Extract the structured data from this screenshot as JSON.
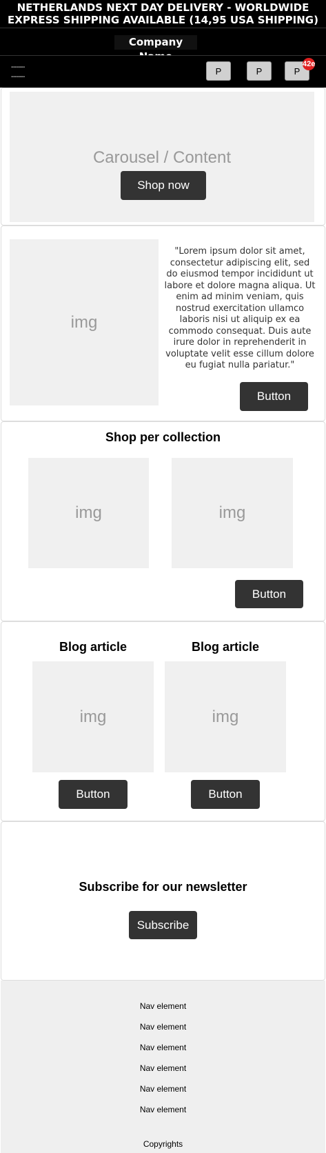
{
  "banner": {
    "line1": "NETHERLANDS NEXT DAY DELIVERY - WORLDWIDE",
    "line2": "EXPRESS SHIPPING AVAILABLE (14,95 USA SHIPPING)"
  },
  "header": {
    "company_name": "Company Name",
    "menu_lines": [
      "-------",
      "-------"
    ],
    "icon_buttons": [
      "P",
      "P",
      "P"
    ],
    "cart_badge": "42e"
  },
  "hero": {
    "placeholder": "Carousel / Content",
    "cta": "Shop now"
  },
  "intro": {
    "img_label": "img",
    "quote": "\"Lorem ipsum dolor sit amet, consectetur adipiscing elit, sed do eiusmod tempor incididunt ut labore et dolore magna aliqua. Ut enim ad minim veniam, quis nostrud exercitation ullamco laboris nisi ut aliquip ex ea commodo consequat. Duis aute irure dolor in reprehenderit in voluptate velit esse cillum dolore eu fugiat nulla pariatur.\"",
    "button": "Button"
  },
  "collections": {
    "title": "Shop per collection",
    "items": [
      {
        "img_label": "img"
      },
      {
        "img_label": "img"
      }
    ],
    "button": "Button"
  },
  "blog": {
    "articles": [
      {
        "title": "Blog article",
        "img_label": "img",
        "button": "Button"
      },
      {
        "title": "Blog article",
        "img_label": "img",
        "button": "Button"
      }
    ]
  },
  "newsletter": {
    "title": "Subscribe for our newsletter",
    "button": "Subscribe"
  },
  "footer": {
    "nav": [
      "Nav element",
      "Nav element",
      "Nav element",
      "Nav element",
      "Nav element",
      "Nav element"
    ],
    "copyright": "Copyrights"
  }
}
